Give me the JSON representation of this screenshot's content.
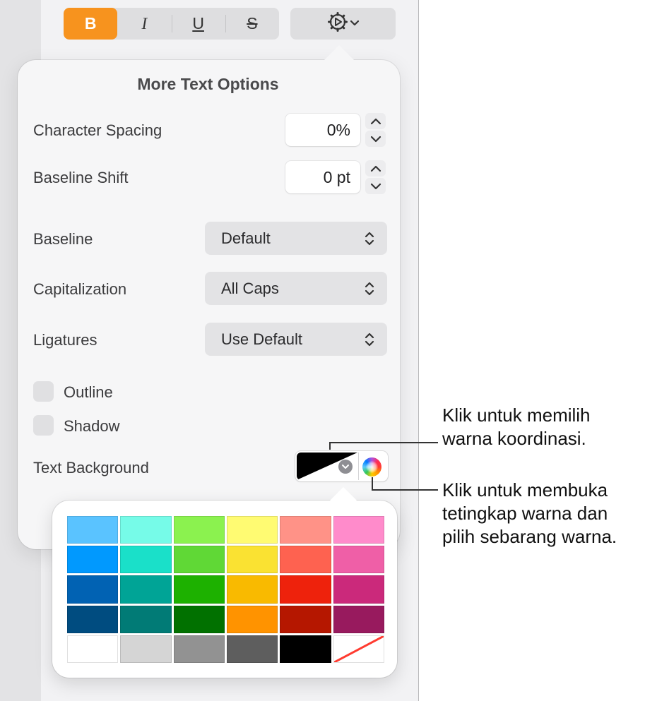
{
  "toolbar": {
    "bold_label": "B",
    "italic_label": "I",
    "underline_label": "U",
    "strike_label": "S",
    "gear_icon": "gear-play-icon",
    "active_color": "#f7931e"
  },
  "popover": {
    "title": "More Text Options",
    "character_spacing": {
      "label": "Character Spacing",
      "value": "0%"
    },
    "baseline_shift": {
      "label": "Baseline Shift",
      "value": "0 pt"
    },
    "baseline": {
      "label": "Baseline",
      "value": "Default"
    },
    "capitalization": {
      "label": "Capitalization",
      "value": "All Caps"
    },
    "ligatures": {
      "label": "Ligatures",
      "value": "Use Default"
    },
    "outline": {
      "label": "Outline",
      "checked": false
    },
    "shadow": {
      "label": "Shadow",
      "checked": false
    },
    "text_background": {
      "label": "Text Background",
      "well_color": "#000000"
    }
  },
  "swatches": [
    [
      "#5ac3ff",
      "#76fbe8",
      "#8bf24f",
      "#fffb72",
      "#ff9287",
      "#ff8bcb"
    ],
    [
      "#0199fe",
      "#1ae0c9",
      "#60d836",
      "#fae232",
      "#fe6250",
      "#ef5fa7"
    ],
    [
      "#0162b3",
      "#00a496",
      "#1db100",
      "#f9ba00",
      "#ee220c",
      "#cb297b"
    ],
    [
      "#004c80",
      "#017b76",
      "#017100",
      "#ff9300",
      "#b51700",
      "#981a5e"
    ],
    [
      "#ffffff",
      "#d5d5d5",
      "#929292",
      "#5e5e5e",
      "#000000",
      "none"
    ]
  ],
  "callouts": {
    "coordinated": "Klik untuk memilih\nwarna koordinasi.",
    "color_window": "Klik untuk membuka\ntetingkap warna dan\npilih sebarang warna."
  }
}
